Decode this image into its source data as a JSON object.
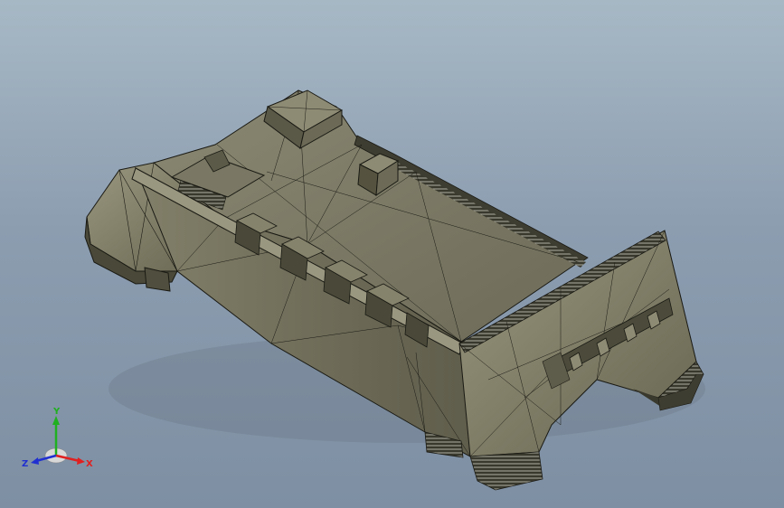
{
  "viewport": {
    "background_top": "#a7b8c5",
    "background_bottom": "#7e8fa3",
    "model_color": "#7c7a66",
    "edge_color": "#1a1a14"
  },
  "triad": {
    "x_label": "X",
    "y_label": "Y",
    "z_label": "Z",
    "x_color": "#e02020",
    "y_color": "#20b020",
    "z_color": "#2030d0"
  }
}
